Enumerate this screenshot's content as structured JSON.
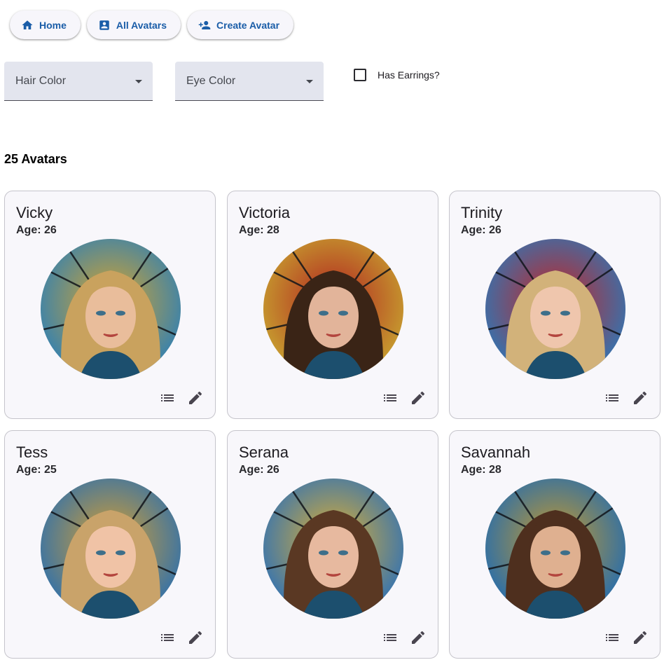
{
  "nav": {
    "home_label": "Home",
    "all_avatars_label": "All Avatars",
    "create_avatar_label": "Create Avatar"
  },
  "filters": {
    "hair_color_label": "Hair Color",
    "eye_color_label": "Eye Color",
    "has_earrings_label": "Has Earrings?",
    "has_earrings_checked": false
  },
  "count_label": "25 Avatars",
  "avatars": [
    {
      "name": "Vicky",
      "age": "Age: 26",
      "hair": "#c9a25e",
      "skin": "#e9bd9b",
      "bg1": "#2b7fb8",
      "bg2": "#d9a52b"
    },
    {
      "name": "Victoria",
      "age": "Age: 28",
      "hair": "#3a2416",
      "skin": "#e2b49a",
      "bg1": "#c8a630",
      "bg2": "#b02020"
    },
    {
      "name": "Trinity",
      "age": "Age: 26",
      "hair": "#d2b27a",
      "skin": "#efc6ad",
      "bg1": "#2c78b8",
      "bg2": "#c62424"
    },
    {
      "name": "Tess",
      "age": "Age: 25",
      "hair": "#c9a36a",
      "skin": "#f0c3a6",
      "bg1": "#2a6fb0",
      "bg2": "#d8a030"
    },
    {
      "name": "Serana",
      "age": "Age: 26",
      "hair": "#5a3823",
      "skin": "#e7b99f",
      "bg1": "#2c70b8",
      "bg2": "#e0b030"
    },
    {
      "name": "Savannah",
      "age": "Age: 28",
      "hair": "#4e2f1e",
      "skin": "#dfb090",
      "bg1": "#1f6bb3",
      "bg2": "#c89a2a"
    }
  ],
  "icons": {
    "home": "home-icon",
    "all_avatars": "contact-card-icon",
    "create_avatar": "person-add-icon",
    "list": "list-icon",
    "edit": "pencil-icon"
  },
  "colors": {
    "accent": "#1a5da8",
    "card_bg": "#f8f7fb",
    "filter_bg": "#e3e5ee"
  }
}
